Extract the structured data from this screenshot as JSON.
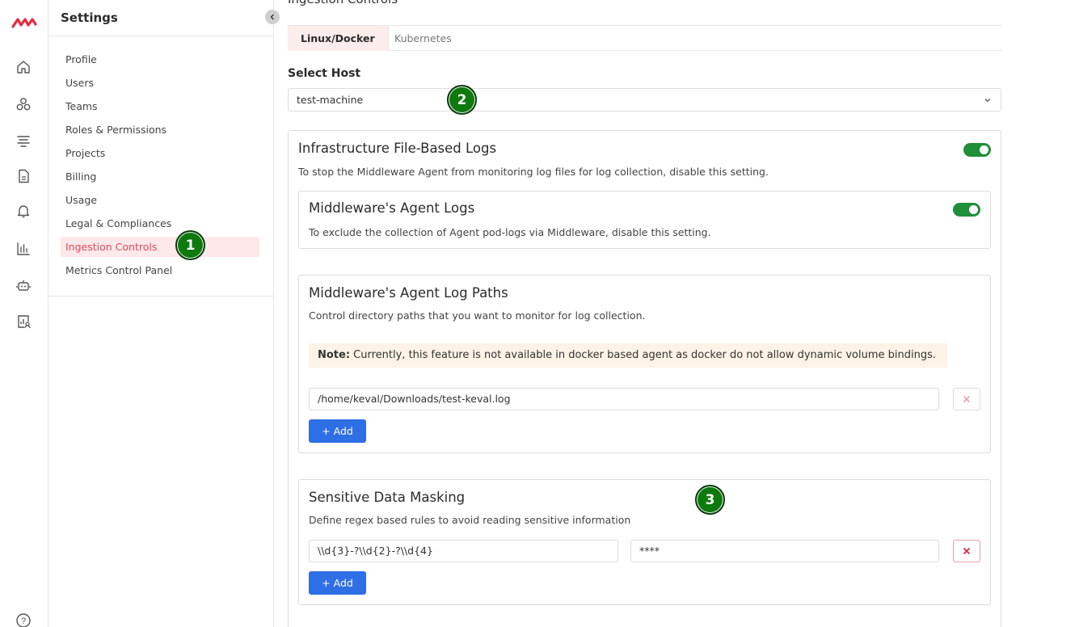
{
  "rail": {
    "logo": "middleware-logo",
    "icons": [
      "home-icon",
      "infrastructure-icon",
      "logs-icon",
      "document-icon",
      "bell-icon",
      "dashboard-icon",
      "bot-icon",
      "user-report-icon",
      "help-icon"
    ],
    "help_glyph": "?"
  },
  "settings": {
    "title": "Settings",
    "menu": [
      {
        "label": "Profile"
      },
      {
        "label": "Users"
      },
      {
        "label": "Teams"
      },
      {
        "label": "Roles & Permissions"
      },
      {
        "label": "Projects"
      },
      {
        "label": "Billing"
      },
      {
        "label": "Usage"
      },
      {
        "label": "Legal & Compliances"
      },
      {
        "label": "Ingestion Controls",
        "active": true
      },
      {
        "label": "Metrics Control Panel"
      }
    ]
  },
  "markers": [
    "1",
    "2",
    "3"
  ],
  "main": {
    "page_title": "Ingestion Controls",
    "tabs": [
      {
        "label": "Linux/Docker",
        "active": true
      },
      {
        "label": "Kubernetes",
        "active": false
      }
    ],
    "host": {
      "label": "Select Host",
      "selected": "test-machine"
    },
    "infra_logs": {
      "title": "Infrastructure File-Based Logs",
      "desc": "To stop the Middleware Agent from monitoring log files for log collection, disable this setting.",
      "enabled": true
    },
    "agent_logs": {
      "title": "Middleware's Agent Logs",
      "desc": "To exclude the collection of Agent pod-logs via Middleware, disable this setting.",
      "enabled": true
    },
    "log_paths": {
      "title": "Middleware's Agent Log Paths",
      "desc": "Control directory paths that you want to monitor for log collection.",
      "note_label": "Note:",
      "note_text": " Currently, this feature is not available in docker based agent as docker do not allow dynamic volume bindings.",
      "paths": [
        "/home/keval/Downloads/test-keval.log"
      ],
      "add_label": "+ Add"
    },
    "masking": {
      "title": "Sensitive Data Masking",
      "desc": "Define regex based rules to avoid reading sensitive information",
      "rules": [
        {
          "regex": "\\\\d{3}-?\\\\d{2}-?\\\\d{4}",
          "replacement": "****"
        }
      ],
      "add_label": "+ Add"
    }
  },
  "colors": {
    "accent_red": "#d94b5f",
    "toggle_green": "#1f8f3a",
    "add_blue": "#2f6fe6",
    "marker_green": "#0e7a0d"
  }
}
